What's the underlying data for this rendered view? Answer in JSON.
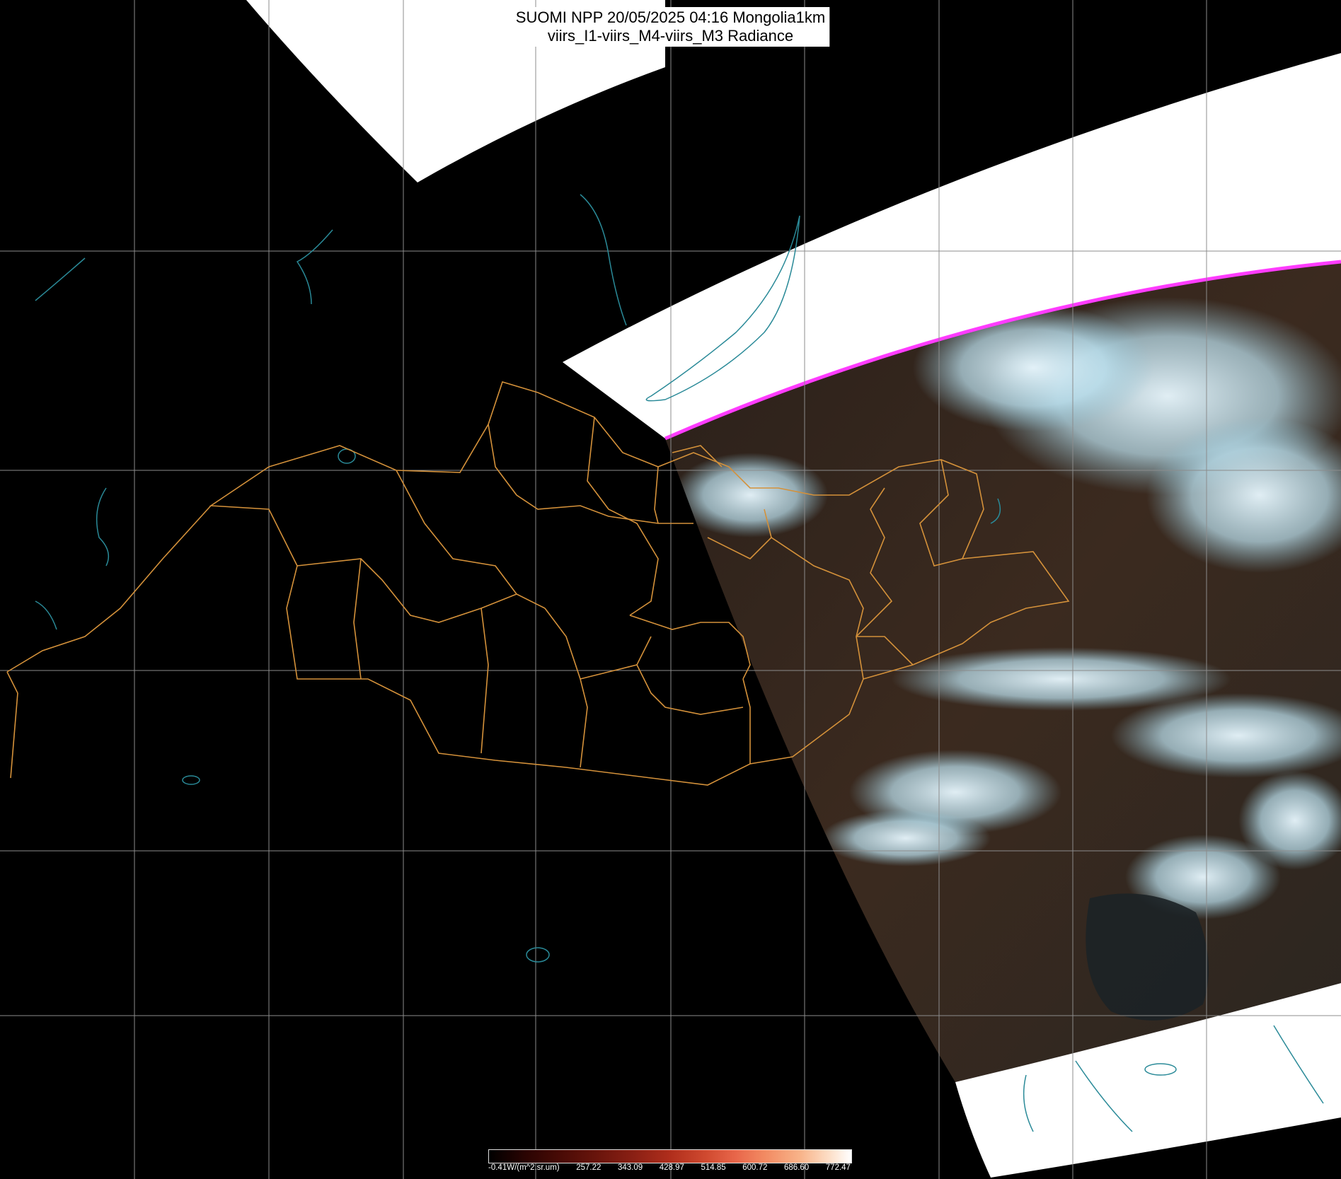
{
  "title": {
    "line1": "SUOMI NPP 20/05/2025 04:16 Mongolia1km",
    "line2": "viirs_I1-viirs_M4-viirs_M3 Radiance"
  },
  "colorbar": {
    "tick_labels": [
      "-0.41W/(m^2.sr.um)",
      "257.22",
      "343.09",
      "428.97",
      "514.85",
      "600.72",
      "686.60",
      "772.47"
    ]
  },
  "colors": {
    "background": "#000000",
    "nodata_white": "#ffffff",
    "grid": "#8c8c8c",
    "borders": "#d4913a",
    "water": "#2a8a98",
    "cloud": "#d8f2ff",
    "land_brown": "#3b2a1f",
    "edge_magenta": "#ff3cff"
  },
  "icons": {
    "map": "map-icon"
  }
}
